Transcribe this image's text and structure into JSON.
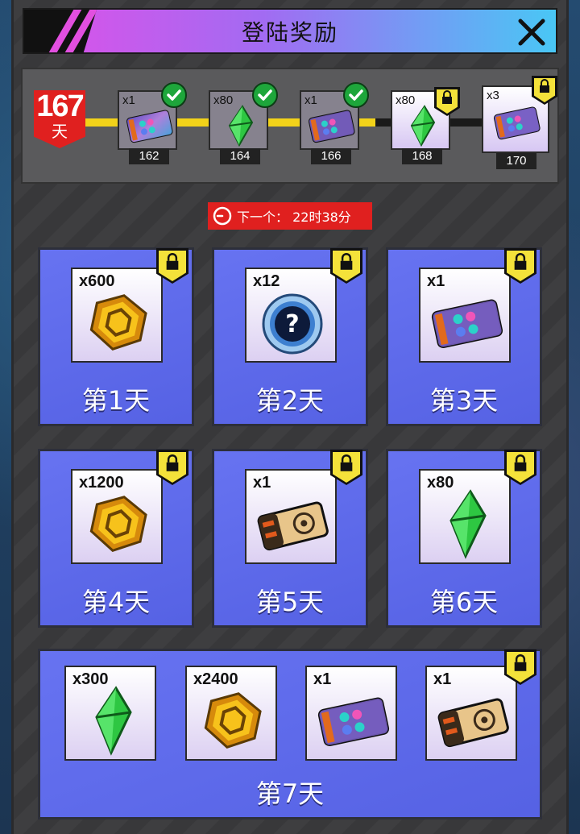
{
  "header": {
    "title": "登陆奖励"
  },
  "streak": {
    "days": "167",
    "unit": "天"
  },
  "milestones": [
    {
      "qty": "x1",
      "day": "162",
      "item": "ticket-card",
      "claimed": true
    },
    {
      "qty": "x80",
      "day": "164",
      "item": "green-gem",
      "claimed": true
    },
    {
      "qty": "x1",
      "day": "166",
      "item": "ticket-card",
      "claimed": true
    },
    {
      "qty": "x80",
      "day": "168",
      "item": "green-gem",
      "claimed": false
    },
    {
      "qty": "x3",
      "day": "170",
      "item": "ticket-card",
      "claimed": false
    }
  ],
  "timer": {
    "text": "下一个： 22时38分"
  },
  "days": [
    {
      "label": "第1天",
      "rewards": [
        {
          "qty": "x600",
          "item": "gold-coin"
        }
      ]
    },
    {
      "label": "第2天",
      "rewards": [
        {
          "qty": "x12",
          "item": "mystery-token"
        }
      ]
    },
    {
      "label": "第3天",
      "rewards": [
        {
          "qty": "x1",
          "item": "ticket-card"
        }
      ]
    },
    {
      "label": "第4天",
      "rewards": [
        {
          "qty": "x1200",
          "item": "gold-coin"
        }
      ]
    },
    {
      "label": "第5天",
      "rewards": [
        {
          "qty": "x1",
          "item": "gold-ticket"
        }
      ]
    },
    {
      "label": "第6天",
      "rewards": [
        {
          "qty": "x80",
          "item": "green-gem"
        }
      ]
    },
    {
      "label": "第7天",
      "rewards": [
        {
          "qty": "x300",
          "item": "green-gem"
        },
        {
          "qty": "x2400",
          "item": "gold-coin"
        },
        {
          "qty": "x1",
          "item": "ticket-card"
        },
        {
          "qty": "x1",
          "item": "gold-ticket"
        }
      ]
    }
  ],
  "colors": {
    "header_gradient": [
      "#e050e8",
      "#49c7f5"
    ],
    "card_blue": "#5a67f0",
    "timer_red": "#e0201f",
    "lock_yellow": "#f4e23a",
    "check_green": "#1ea63b"
  }
}
